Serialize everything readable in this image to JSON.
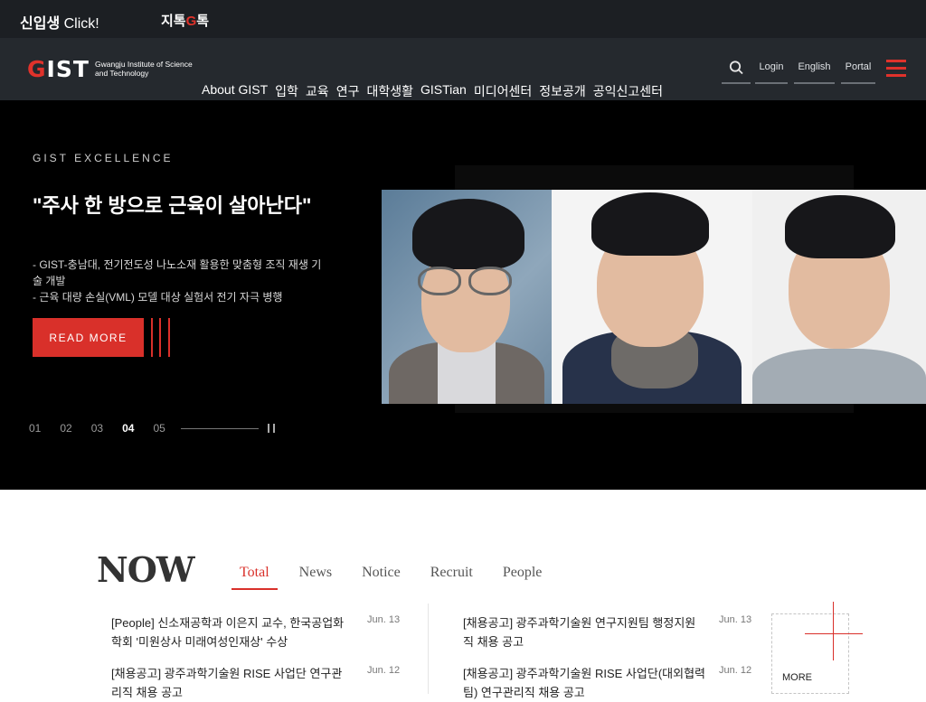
{
  "topbar": {
    "freshman_bold": "신입생",
    "freshman_click": "Click!",
    "jitok_pre": "지톡",
    "jitok_g": "G",
    "jitok_post": "톡"
  },
  "header": {
    "logo_mark_g": "G",
    "logo_mark_rest": "IST",
    "logo_sub": "Gwangju Institute of Science and Technology",
    "nav": [
      "About GIST",
      "입학",
      "교육",
      "연구",
      "대학생활",
      "GISTian",
      "미디어센터",
      "정보공개",
      "공익신고센터"
    ],
    "util": {
      "search_icon": "search-icon",
      "login": "Login",
      "english": "English",
      "portal": "Portal",
      "menu_icon": "hamburger-menu-icon"
    }
  },
  "hero": {
    "kicker": "GIST EXCELLENCE",
    "headline": "\"주사 한 방으로 근육이 살아난다\"",
    "desc_line1": "- GIST-충남대, 전기전도성 나노소재 활용한 맞춤형 조직 재생 기술 개발",
    "desc_line2": "- 근육 대량 손실(VML) 모델 대상 실험서 전기 자극 병행",
    "read_more": "READ MORE",
    "pager": [
      "01",
      "02",
      "03",
      "04",
      "05"
    ],
    "active_slide": "04",
    "accent": "#d9302a"
  },
  "now": {
    "title": "NOW",
    "tabs": [
      "Total",
      "News",
      "Notice",
      "Recruit",
      "People"
    ],
    "active_tab": "Total",
    "left_items": [
      {
        "title": "[People] 신소재공학과 이은지 교수, 한국공업화학회 '미원상사 미래여성인재상' 수상",
        "date": "Jun. 13"
      },
      {
        "title": "[채용공고] 광주과학기술원 RISE 사업단 연구관리직 채용 공고",
        "date": "Jun. 12"
      }
    ],
    "right_items": [
      {
        "title": "[채용공고] 광주과학기술원 연구지원팀 행정지원직 채용 공고",
        "date": "Jun. 13"
      },
      {
        "title": "[채용공고] 광주과학기술원 RISE 사업단(대외협력팀) 연구관리직 채용 공고",
        "date": "Jun. 12"
      }
    ],
    "more": "MORE"
  }
}
